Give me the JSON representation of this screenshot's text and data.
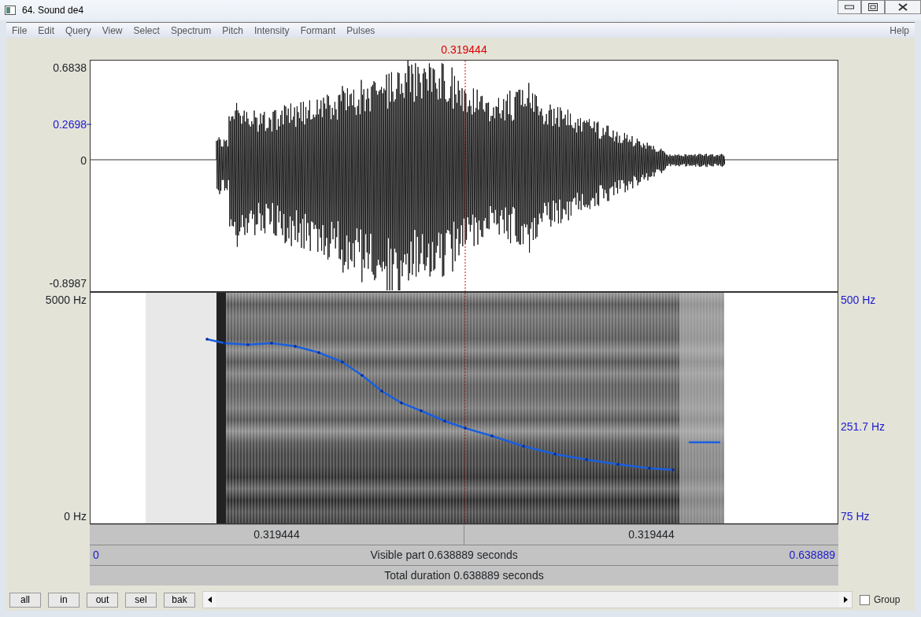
{
  "window": {
    "title": "64. Sound de4"
  },
  "menu": [
    "File",
    "Edit",
    "Query",
    "View",
    "Select",
    "Spectrum",
    "Pitch",
    "Intensity",
    "Formant",
    "Pulses"
  ],
  "help_menu": "Help",
  "cursor": {
    "time": "0.319444"
  },
  "waveform": {
    "y_labels": [
      {
        "text": "0.6838",
        "highlighted": false
      },
      {
        "text": "0.2698",
        "highlighted": true
      },
      {
        "text": "0",
        "highlighted": false
      },
      {
        "text": "-0.8987",
        "highlighted": false
      }
    ]
  },
  "spectrogram": {
    "left_labels": [
      "5000 Hz",
      "0 Hz"
    ],
    "right_labels": [
      "500 Hz",
      "251.7 Hz",
      "75 Hz"
    ]
  },
  "time_bar": {
    "segments": [
      "0.319444",
      "0.319444"
    ],
    "start": "0",
    "visible": "Visible part 0.638889 seconds",
    "end": "0.638889",
    "total": "Total duration 0.638889 seconds"
  },
  "buttons": [
    "all",
    "in",
    "out",
    "sel",
    "bak"
  ],
  "group": {
    "label": "Group",
    "checked": false
  }
}
